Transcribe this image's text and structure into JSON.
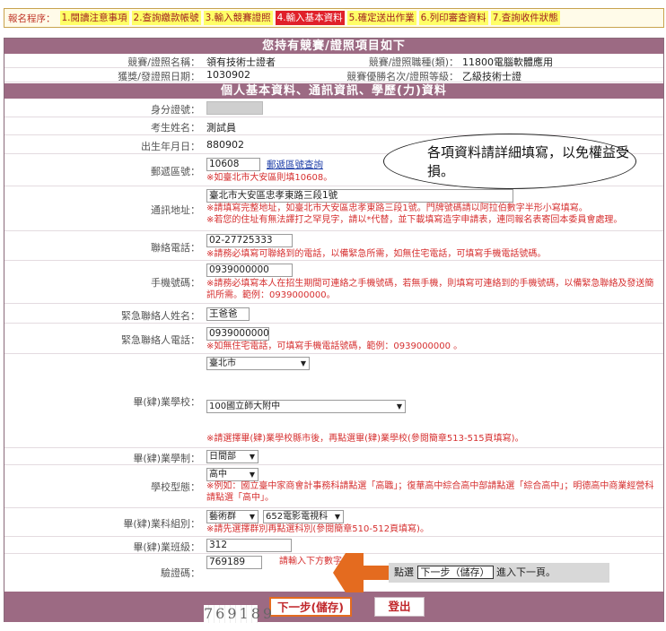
{
  "progress": {
    "label": "報名程序：",
    "steps": [
      "1.閱讀注意事項",
      "2.查詢繳款帳號",
      "3.輸入競賽證照",
      "4.輸入基本資料",
      "5.確定送出作業",
      "6.列印審查資料",
      "7.查詢收件狀態"
    ],
    "active_index": 3
  },
  "section1": {
    "title": "您持有競賽/證照項目如下",
    "name_label": "競賽/證照名稱：",
    "name_value": "領有技術士證者",
    "category_label": "競賽/證照職種(類)：",
    "category_value": "11800電腦軟體應用",
    "date_label": "獲獎/發證照日期：",
    "date_value": "1030902",
    "rank_label": "競賽優勝名次/證照等級：",
    "rank_value": "乙級技術士證"
  },
  "section2": {
    "title": "個人基本資料、通訊資訊、學歷(力)資料"
  },
  "callout": {
    "text": "各項資料請詳細填寫，以免權益受損。"
  },
  "fields": {
    "id_label": "身分證號：",
    "name_label": "考生姓名：",
    "name_value": "測試員",
    "birth_label": "出生年月日：",
    "birth_value": "880902",
    "zip_label": "郵遞區號：",
    "zip_value": "10608",
    "zip_link": "郵遞區號查詢",
    "zip_note": "※如臺北市大安區則填10608。",
    "address_label": "通訊地址：",
    "address_value": "臺北市大安區忠孝東路三段1號",
    "address_note1": "※請填寫完整地址，如臺北市大安區忠孝東路三段1號。門牌號碼請以阿拉伯數字半形小寫填寫。",
    "address_note2": "※若您的住址有無法譯打之罕見字，請以*代替，並下載填寫造字申請表，連同報名表寄回本委員會處理。",
    "phone_label": "聯絡電話：",
    "phone_value": "02-27725333",
    "phone_note": "※請務必填寫可聯絡到的電話，以備緊急所需，如無住宅電話，可填寫手機電話號碼。",
    "mobile_label": "手機號碼：",
    "mobile_value": "0939000000",
    "mobile_note": "※請務必填寫本人在招生期間可連絡之手機號碼，若無手機，則填寫可連絡到的手機號碼，以備緊急聯絡及發送簡訊所需。範例：0939000000。",
    "emg_name_label": "緊急聯絡人姓名：",
    "emg_name_value": "王爸爸",
    "emg_phone_label": "緊急聯絡人電話：",
    "emg_phone_value": "0939000000",
    "emg_phone_note": "※如無住宅電話，可填寫手機電話號碼，範例：0939000000 。",
    "school_label": "畢(肄)業學校：",
    "school_city": "臺北市",
    "school_name": "100國立師大附中",
    "school_note": "※請選擇畢(肄)業學校縣市後，再點選畢(肄)業學校(參閱簡章513-515頁填寫)。",
    "system_label": "畢(肄)業學制：",
    "system_value": "日間部",
    "type_label": "學校型態：",
    "type_value": "高中",
    "type_note": "※例如：國立臺中家商會計事務科請點選「高職」；復華高中綜合高中部請點選「綜合高中」；明德高中商業經營科請點選「高中」。",
    "dept_label": "畢(肄)業科組別：",
    "dept_group": "藝術群",
    "dept_value": "652電影電視科",
    "dept_note": "※請先選擇群別再點選科別(參閱簡章510-512頁填寫)。",
    "class_label": "畢(肄)業班級：",
    "class_value": "312",
    "captcha_label": "驗證碼：",
    "captcha_value": "769189",
    "captcha_hint": "請輸入下方數字",
    "captcha_image_text": "769189"
  },
  "hint": {
    "prefix": "點選",
    "boxed": "下一步（儲存）",
    "suffix": "進入下一頁。"
  },
  "buttons": {
    "next": "下一步(儲存)",
    "exit": "登出"
  },
  "colors": {
    "band": "#9c6a83",
    "active_step": "#e0202a",
    "step": "#ffff66",
    "note": "#d63030",
    "arrow": "#e46b1f"
  }
}
